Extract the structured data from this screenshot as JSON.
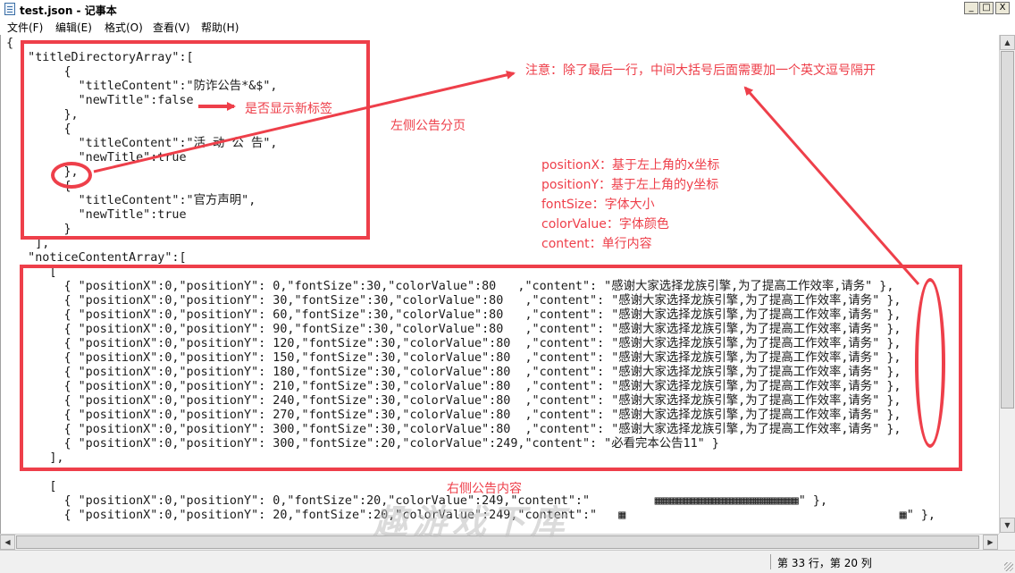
{
  "window": {
    "title": "test.json - 记事本",
    "controls": {
      "minimize": "_",
      "maximize": "□",
      "close": "X"
    }
  },
  "menu": [
    "文件(F)",
    "编辑(E)",
    "格式(O)",
    "查看(V)",
    "帮助(H)"
  ],
  "editor": {
    "lines": [
      "{",
      "   \"titleDirectoryArray\":[",
      "        {",
      "          \"titleContent\":\"防诈公告*&$\",",
      "          \"newTitle\":false",
      "        },",
      "        {",
      "          \"titleContent\":\"活 动 公 告\",",
      "          \"newTitle\":true",
      "        },",
      "        {",
      "          \"titleContent\":\"官方声明\",",
      "          \"newTitle\":true",
      "        }",
      "    ],",
      "   \"noticeContentArray\":[",
      "      [",
      "        { \"positionX\":0,\"positionY\": 0,\"fontSize\":30,\"colorValue\":80   ,\"content\": \"感谢大家选择龙族引擎,为了提高工作效率,请务\" },",
      "        { \"positionX\":0,\"positionY\": 30,\"fontSize\":30,\"colorValue\":80   ,\"content\": \"感谢大家选择龙族引擎,为了提高工作效率,请务\" },",
      "        { \"positionX\":0,\"positionY\": 60,\"fontSize\":30,\"colorValue\":80   ,\"content\": \"感谢大家选择龙族引擎,为了提高工作效率,请务\" },",
      "        { \"positionX\":0,\"positionY\": 90,\"fontSize\":30,\"colorValue\":80   ,\"content\": \"感谢大家选择龙族引擎,为了提高工作效率,请务\" },",
      "        { \"positionX\":0,\"positionY\": 120,\"fontSize\":30,\"colorValue\":80  ,\"content\": \"感谢大家选择龙族引擎,为了提高工作效率,请务\" },",
      "        { \"positionX\":0,\"positionY\": 150,\"fontSize\":30,\"colorValue\":80  ,\"content\": \"感谢大家选择龙族引擎,为了提高工作效率,请务\" },",
      "        { \"positionX\":0,\"positionY\": 180,\"fontSize\":30,\"colorValue\":80  ,\"content\": \"感谢大家选择龙族引擎,为了提高工作效率,请务\" },",
      "        { \"positionX\":0,\"positionY\": 210,\"fontSize\":30,\"colorValue\":80  ,\"content\": \"感谢大家选择龙族引擎,为了提高工作效率,请务\" },",
      "        { \"positionX\":0,\"positionY\": 240,\"fontSize\":30,\"colorValue\":80  ,\"content\": \"感谢大家选择龙族引擎,为了提高工作效率,请务\" },",
      "        { \"positionX\":0,\"positionY\": 270,\"fontSize\":30,\"colorValue\":80  ,\"content\": \"感谢大家选择龙族引擎,为了提高工作效率,请务\" },",
      "        { \"positionX\":0,\"positionY\": 300,\"fontSize\":30,\"colorValue\":80  ,\"content\": \"感谢大家选择龙族引擎,为了提高工作效率,请务\" },",
      "        { \"positionX\":0,\"positionY\": 300,\"fontSize\":20,\"colorValue\":249,\"content\": \"必看完本公告11\" }",
      "      ],",
      "",
      "      [",
      "        { \"positionX\":0,\"positionY\": 0,\"fontSize\":20,\"colorValue\":249,\"content\":\"         ▦▦▦▦▦▦▦▦▦▦▦▦▦▦▦▦▦▦▦▦\" },",
      "        { \"positionX\":0,\"positionY\": 20,\"fontSize\":20,\"colorValue\":249,\"content\":\"   ▦                                      ▦\" },"
    ]
  },
  "annotations": {
    "note_comma": "注意：除了最后一行，中间大括号后面需要加一个英文逗号隔开",
    "note_new_title": "是否显示新标签",
    "note_left_tabs": "左侧公告分页",
    "note_right_content": "右侧公告内容",
    "legend": [
      "positionX：基于左上角的x坐标",
      "positionY：基于左上角的y坐标",
      "fontSize：字体大小",
      "colorValue：字体颜色",
      "content：单行内容"
    ],
    "color": "#ee3f4a"
  },
  "watermark": "趣游戏下库",
  "statusbar": {
    "position": "第 33 行，第 20 列"
  }
}
